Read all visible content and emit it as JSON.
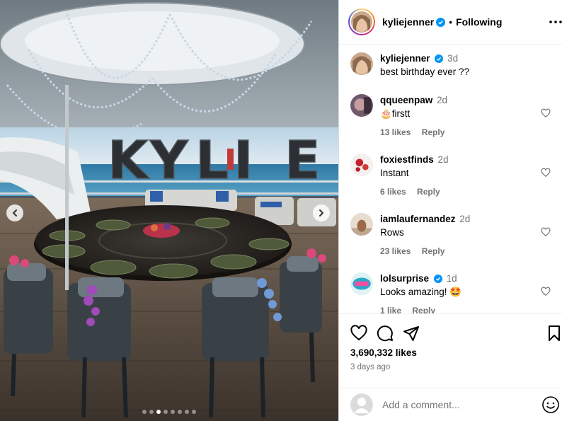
{
  "post": {
    "author": "kyliejenner",
    "separator": "•",
    "follow_label": "Following",
    "caption_time": "3d",
    "caption": "best birthday ever ??",
    "likes": "3,690,332 likes",
    "posted_ago": "3 days ago",
    "comment_placeholder": "Add a comment...",
    "carousel": {
      "total": 8,
      "active_index": 2
    },
    "balloon_letters": [
      "K",
      "Y",
      "L",
      "I",
      "E"
    ]
  },
  "comments": [
    {
      "user": "qqueenpaw",
      "time": "2d",
      "text": "🎂firstt",
      "likes": "13 likes",
      "reply": "Reply"
    },
    {
      "user": "foxiestfinds",
      "time": "2d",
      "text": "Instant",
      "likes": "6 likes",
      "reply": "Reply"
    },
    {
      "user": "iamlaufernandez",
      "time": "2d",
      "text": "Rows",
      "likes": "23 likes",
      "reply": "Reply"
    },
    {
      "user": "lolsurprise",
      "time": "1d",
      "text": "Looks amazing! 🤩",
      "likes": "1 like",
      "reply": "Reply"
    }
  ],
  "icons": [
    "chevron-left-icon",
    "chevron-right-icon",
    "verified-icon",
    "more-icon",
    "heart-icon",
    "comment-icon",
    "share-icon",
    "save-icon",
    "emoji-icon"
  ],
  "colors": {
    "verified": "#0095f6",
    "muted": "#737373",
    "border": "#dbdbdb",
    "sea": "#3f7fa6"
  }
}
